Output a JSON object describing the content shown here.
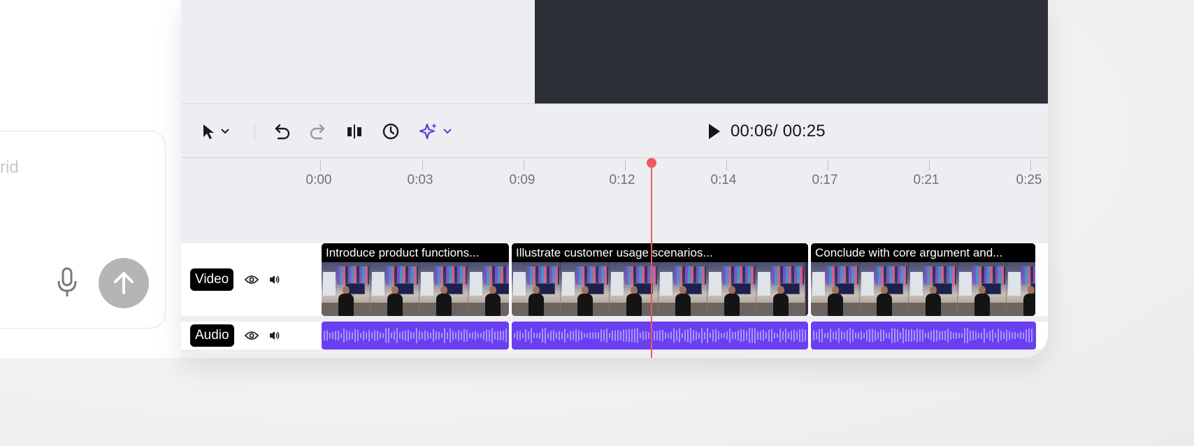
{
  "chat": {
    "placeholder_fragment": "rid",
    "mic_icon": "microphone-icon",
    "send_icon": "arrow-up-icon"
  },
  "toolbar": {
    "select_tool_icon": "cursor-arrow-icon",
    "dropdown_icon": "chevron-down-icon",
    "undo_icon": "undo-icon",
    "redo_icon": "redo-icon",
    "split_icon": "split-clip-icon",
    "speed_icon": "speed-dial-icon",
    "ai_icon": "sparkle-icon",
    "play_icon": "play-icon",
    "time_current": "00:06",
    "time_total": "00:25",
    "time_display": "00:06/ 00:25",
    "accent_color": "#5b3fd6"
  },
  "ruler": {
    "ticks": [
      "0:00",
      "0:03",
      "0:09",
      "0:12",
      "0:14",
      "0:17",
      "0:21",
      "0:25"
    ]
  },
  "playhead": {
    "color": "#ef5a5a"
  },
  "tracks": {
    "video": {
      "label": "Video",
      "clips": [
        {
          "title": "Introduce product functions..."
        },
        {
          "title": "Illustrate customer usage scenarios..."
        },
        {
          "title": "Conclude with core argument and..."
        }
      ]
    },
    "audio": {
      "label": "Audio",
      "color": "#6a3ff2"
    },
    "visibility_icon": "eye-icon",
    "volume_icon": "speaker-icon"
  }
}
